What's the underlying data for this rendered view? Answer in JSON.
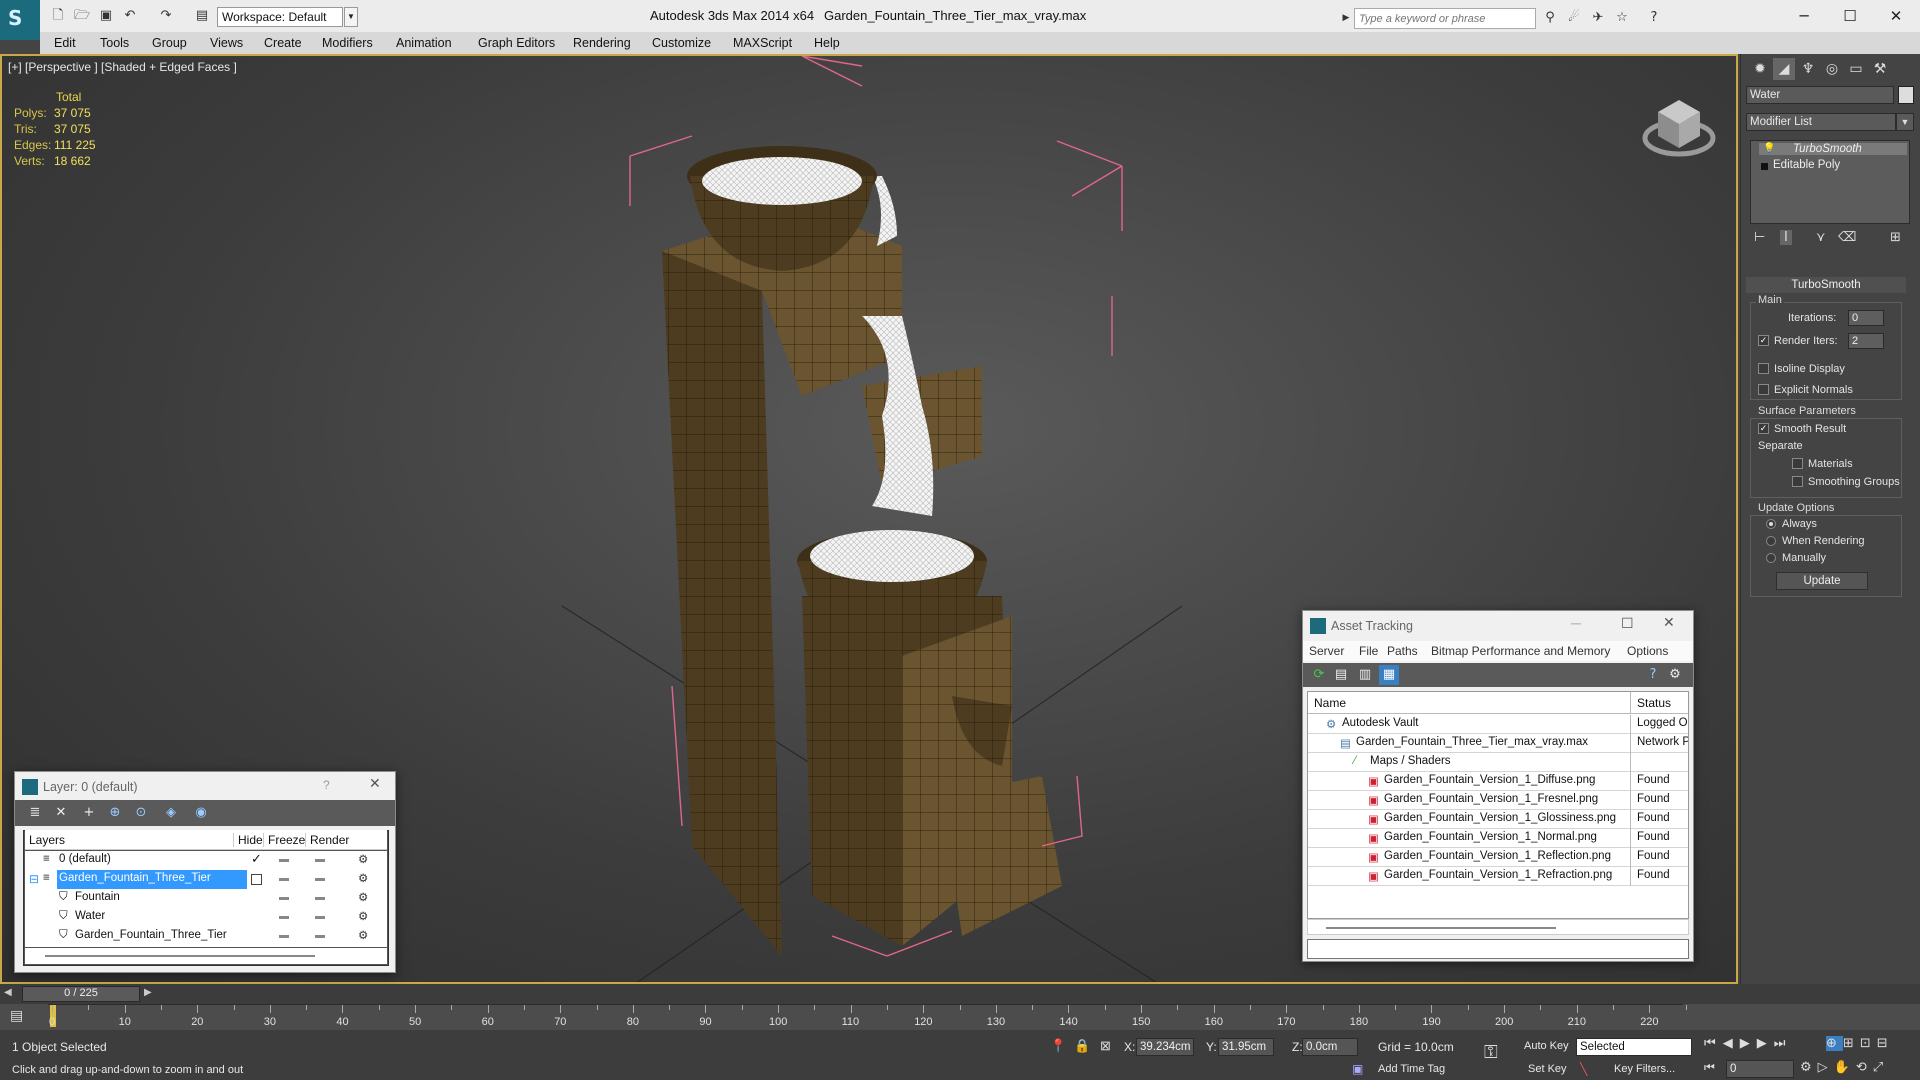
{
  "titlebar": {
    "workspace": "Workspace: Default",
    "app_title": "Autodesk 3ds Max  2014 x64",
    "file_title": "Garden_Fountain_Three_Tier_max_vray.max",
    "search_placeholder": "Type a keyword or phrase",
    "minimize": "─",
    "maximize": "☐",
    "close": "✕"
  },
  "menu": [
    "Edit",
    "Tools",
    "Group",
    "Views",
    "Create",
    "Modifiers",
    "Animation",
    "Graph Editors",
    "Rendering",
    "Customize",
    "MAXScript",
    "Help"
  ],
  "viewport": {
    "label": "[+] [Perspective ] [Shaded + Edged Faces ]",
    "stats_header": "Total",
    "stats": [
      {
        "label": "Polys:",
        "value": "37 075"
      },
      {
        "label": "Tris:",
        "value": "37 075"
      },
      {
        "label": "Edges:",
        "value": "111 225"
      },
      {
        "label": "Verts:",
        "value": "18 662"
      }
    ]
  },
  "command_panel": {
    "object_name": "Water",
    "modifier_list": "Modifier List",
    "stack": [
      "TurboSmooth",
      "Editable Poly"
    ],
    "rollout_title": "TurboSmooth",
    "main_group": "Main",
    "iterations_label": "Iterations:",
    "iterations_value": "0",
    "render_iters_label": "Render Iters:",
    "render_iters_value": "2",
    "render_iters_checked": true,
    "isoline_label": "Isoline Display",
    "explicit_normals_label": "Explicit Normals",
    "surface_group": "Surface Parameters",
    "smooth_result_label": "Smooth Result",
    "separate_label": "Separate",
    "materials_label": "Materials",
    "smoothing_groups_label": "Smoothing Groups",
    "update_group": "Update Options",
    "always_label": "Always",
    "when_rendering_label": "When Rendering",
    "manually_label": "Manually",
    "update_button": "Update",
    "selected_update": "Always"
  },
  "layer_dialog": {
    "title": "Layer: 0 (default)",
    "help": "?",
    "close": "✕",
    "columns": [
      "Layers",
      "Hide",
      "Freeze",
      "Render"
    ],
    "rows": [
      {
        "name": "0 (default)",
        "indent": 0,
        "active": true,
        "selected": false
      },
      {
        "name": "Garden_Fountain_Three_Tier",
        "indent": 0,
        "active": false,
        "selected": true
      },
      {
        "name": "Fountain",
        "indent": 1,
        "active": false,
        "selected": false
      },
      {
        "name": "Water",
        "indent": 1,
        "active": false,
        "selected": false
      },
      {
        "name": "Garden_Fountain_Three_Tier",
        "indent": 1,
        "active": false,
        "selected": false
      }
    ]
  },
  "asset_dialog": {
    "title": "Asset Tracking",
    "menu": [
      "Server",
      "File",
      "Paths",
      "Bitmap Performance and Memory",
      "Options"
    ],
    "columns": [
      "Name",
      "Status"
    ],
    "rows": [
      {
        "name": "Autodesk Vault",
        "status": "Logged Ou",
        "indent": 0
      },
      {
        "name": "Garden_Fountain_Three_Tier_max_vray.max",
        "status": "Network P",
        "indent": 1
      },
      {
        "name": "Maps / Shaders",
        "status": "",
        "indent": 2
      },
      {
        "name": "Garden_Fountain_Version_1_Diffuse.png",
        "status": "Found",
        "indent": 3
      },
      {
        "name": "Garden_Fountain_Version_1_Fresnel.png",
        "status": "Found",
        "indent": 3
      },
      {
        "name": "Garden_Fountain_Version_1_Glossiness.png",
        "status": "Found",
        "indent": 3
      },
      {
        "name": "Garden_Fountain_Version_1_Normal.png",
        "status": "Found",
        "indent": 3
      },
      {
        "name": "Garden_Fountain_Version_1_Reflection.png",
        "status": "Found",
        "indent": 3
      },
      {
        "name": "Garden_Fountain_Version_1_Refraction.png",
        "status": "Found",
        "indent": 3
      }
    ]
  },
  "timeline": {
    "frame_display": "0 / 225",
    "ticks": [
      "0",
      "10",
      "20",
      "30",
      "40",
      "50",
      "60",
      "70",
      "80",
      "90",
      "100",
      "110",
      "120",
      "130",
      "140",
      "150",
      "160",
      "170",
      "180",
      "190",
      "200",
      "210",
      "220"
    ]
  },
  "status": {
    "selection": "1 Object Selected",
    "prompt": "Click and drag up-and-down to zoom in and out",
    "x_label": "X:",
    "x_value": "39.234cm",
    "y_label": "Y:",
    "y_value": "31.95cm",
    "z_label": "Z:",
    "z_value": "0.0cm",
    "grid": "Grid = 10.0cm",
    "add_time_tag": "Add Time Tag",
    "auto_key": "Auto Key",
    "set_key": "Set Key",
    "key_mode": "Selected",
    "key_filters": "Key Filters...",
    "current_frame": "0"
  },
  "colors": {
    "viewport_border": "#c7a84a",
    "stats_yellow": "#f0e05a",
    "selection_blue": "#3399ff",
    "bbox_pink": "#e0668a"
  }
}
